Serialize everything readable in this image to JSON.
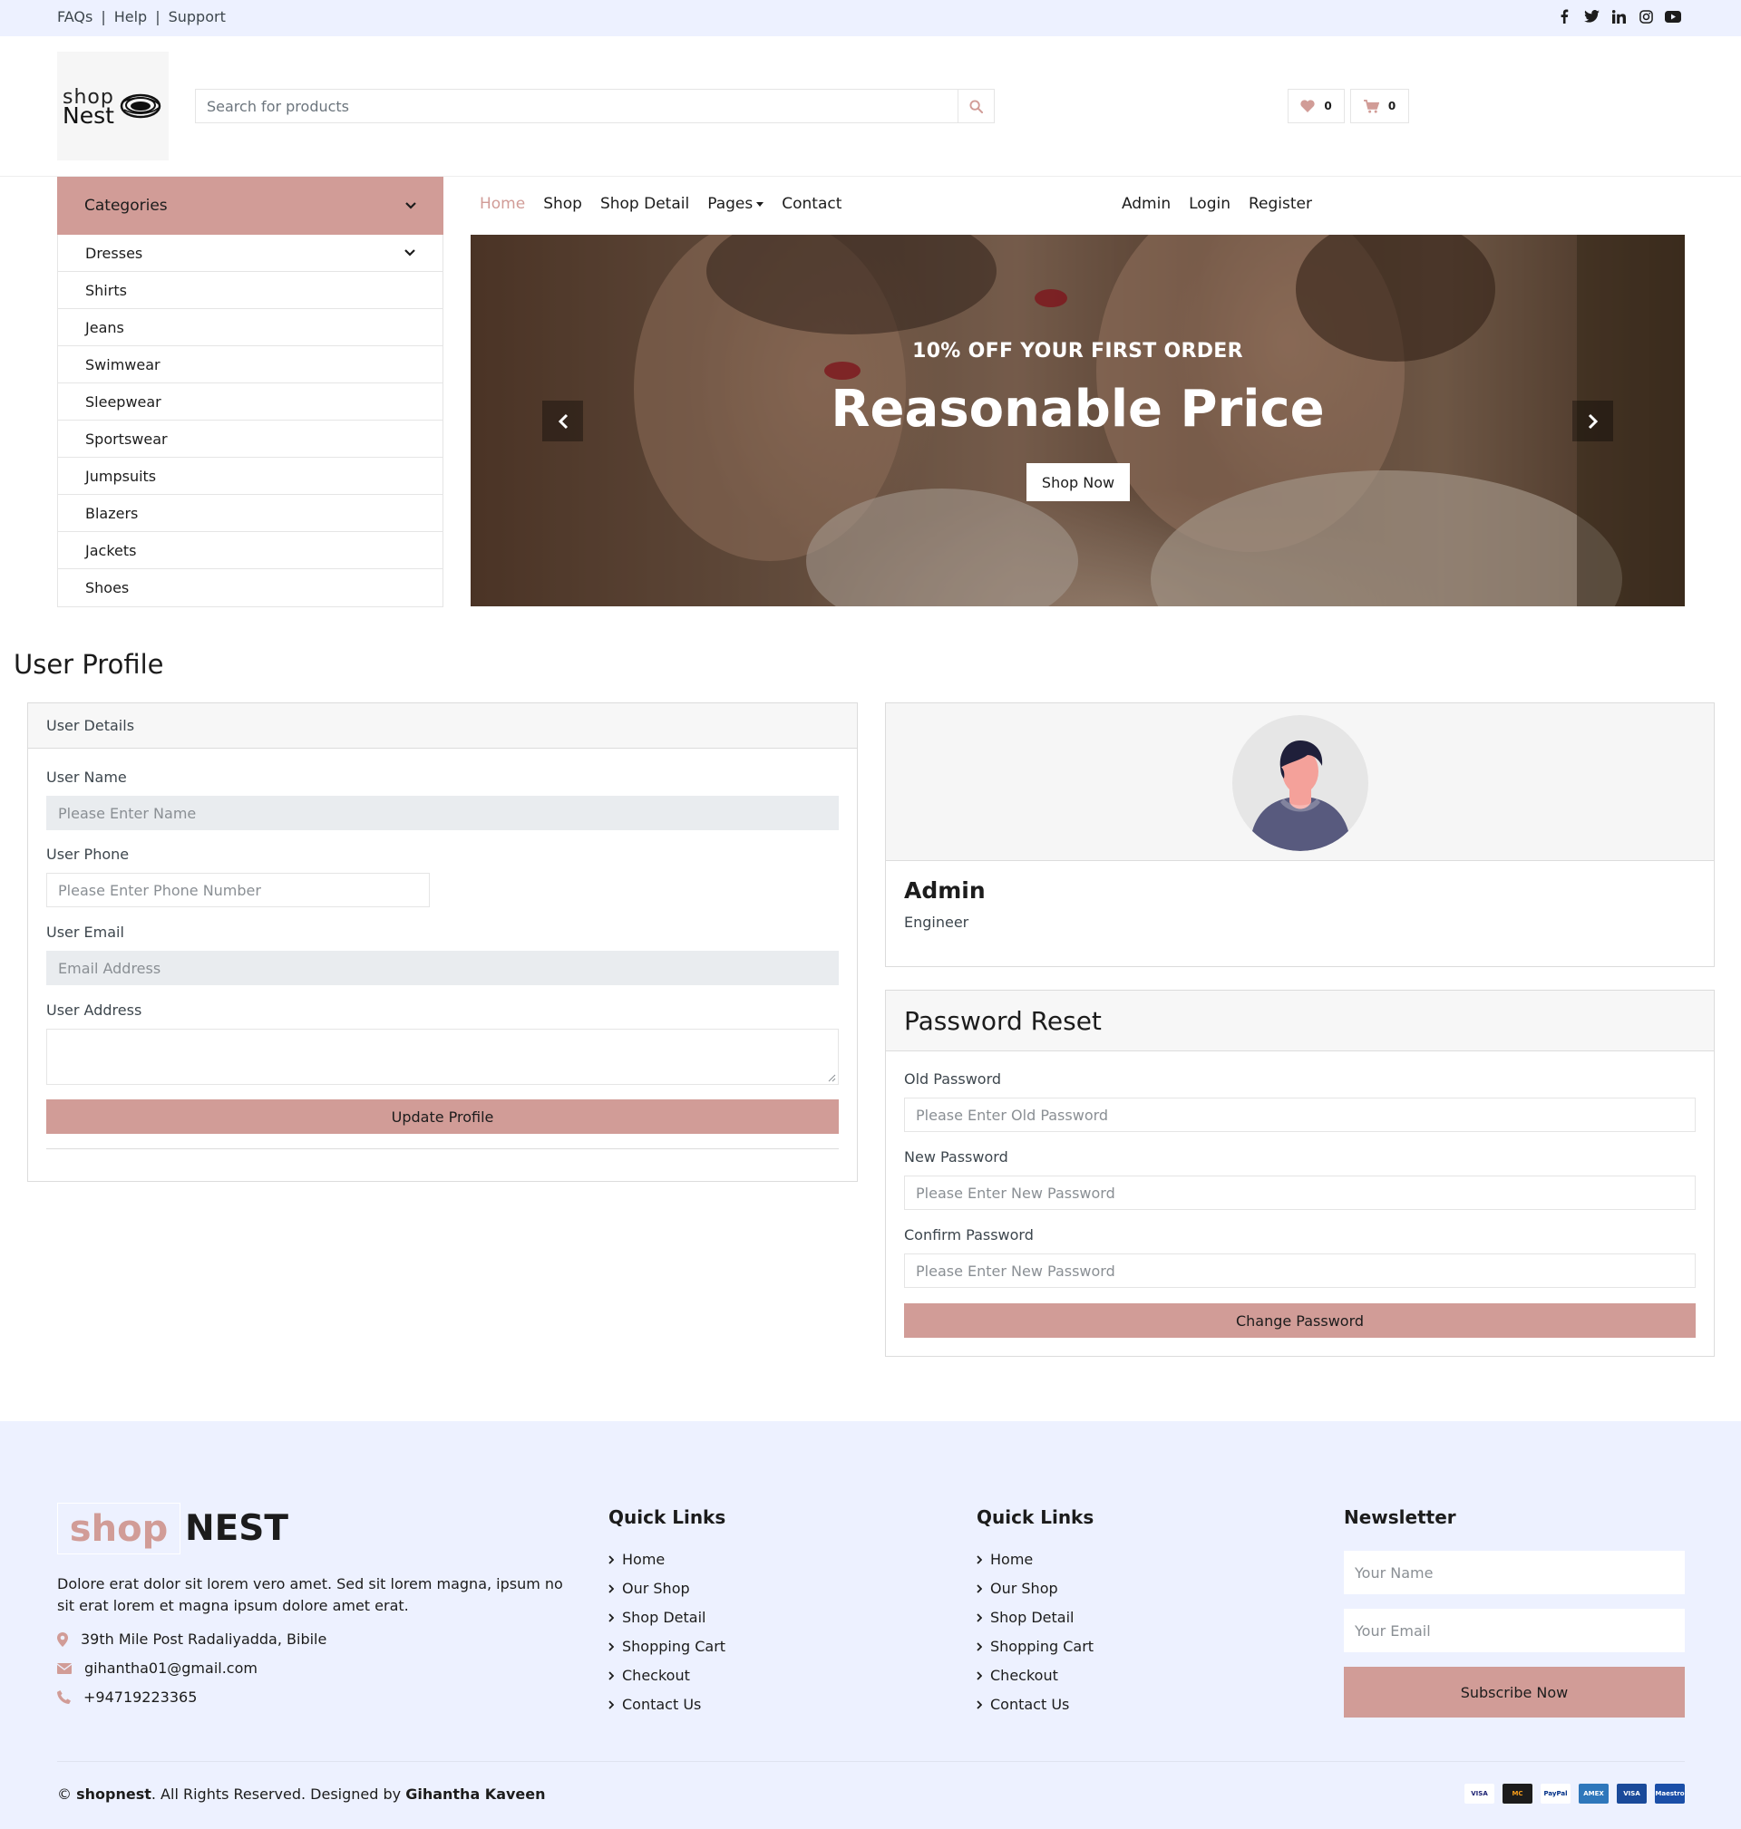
{
  "topbar": {
    "links": [
      "FAQs",
      "Help",
      "Support"
    ],
    "social_icons": [
      "facebook-icon",
      "twitter-icon",
      "linkedin-icon",
      "instagram-icon",
      "youtube-icon"
    ]
  },
  "header": {
    "logo_line1": "shop",
    "logo_line2": "Nest",
    "search_placeholder": "Search for products",
    "wishlist_count": "0",
    "cart_count": "0"
  },
  "categories": {
    "title": "Categories",
    "items": [
      "Dresses",
      "Shirts",
      "Jeans",
      "Swimwear",
      "Sleepwear",
      "Sportswear",
      "Jumpsuits",
      "Blazers",
      "Jackets",
      "Shoes"
    ]
  },
  "nav": {
    "left": [
      "Home",
      "Shop",
      "Shop Detail",
      "Pages",
      "Contact"
    ],
    "active": "Home",
    "right": [
      "Admin",
      "Login",
      "Register"
    ]
  },
  "hero": {
    "subtitle": "10% OFF YOUR FIRST ORDER",
    "title": "Reasonable Price",
    "button": "Shop Now"
  },
  "profile": {
    "page_title": "User Profile",
    "card_title": "User Details",
    "name_label": "User Name",
    "name_placeholder": "Please Enter Name",
    "phone_label": "User Phone",
    "phone_placeholder": "Please Enter Phone Number",
    "email_label": "User Email",
    "email_placeholder": "Email Address",
    "address_label": "User Address",
    "update_button": "Update Profile"
  },
  "user_card": {
    "name": "Admin",
    "role": "Engineer"
  },
  "password": {
    "title": "Password Reset",
    "old_label": "Old Password",
    "old_placeholder": "Please Enter Old Password",
    "new_label": "New Password",
    "new_placeholder": "Please Enter New Password",
    "confirm_label": "Confirm Password",
    "confirm_placeholder": "Please Enter New Password",
    "button": "Change Password"
  },
  "footer": {
    "logo_shop": "shop",
    "logo_nest": "NEST",
    "description": "Dolore erat dolor sit lorem vero amet. Sed sit lorem magna, ipsum no sit erat lorem et magna ipsum dolore amet erat.",
    "address": "39th Mile Post Radaliyadda, Bibile",
    "email": "gihantha01@gmail.com",
    "phone": "+94719223365",
    "quick_links_1_title": "Quick Links",
    "quick_links_1": [
      "Home",
      "Our Shop",
      "Shop Detail",
      "Shopping Cart",
      "Checkout",
      "Contact Us"
    ],
    "quick_links_2_title": "Quick Links",
    "quick_links_2": [
      "Home",
      "Our Shop",
      "Shop Detail",
      "Shopping Cart",
      "Checkout",
      "Contact Us"
    ],
    "newsletter_title": "Newsletter",
    "newsletter_name_placeholder": "Your Name",
    "newsletter_email_placeholder": "Your Email",
    "newsletter_button": "Subscribe Now",
    "copyright_symbol": "©",
    "copyright_brand": "shopnest",
    "copyright_text": ". All Rights Reserved. Designed by ",
    "copyright_author": "Gihantha Kaveen",
    "payment_icons": [
      "visa-icon",
      "mastercard-icon",
      "paypal-icon",
      "amex-icon",
      "visa-electron-icon",
      "maestro-icon"
    ],
    "payment_labels": [
      "VISA",
      "MC",
      "PayPal",
      "AMEX",
      "VISA",
      "Maestro"
    ]
  },
  "colors": {
    "accent": "#d19c97",
    "topbar_bg": "#edf1ff",
    "text": "#1c1c1c"
  }
}
